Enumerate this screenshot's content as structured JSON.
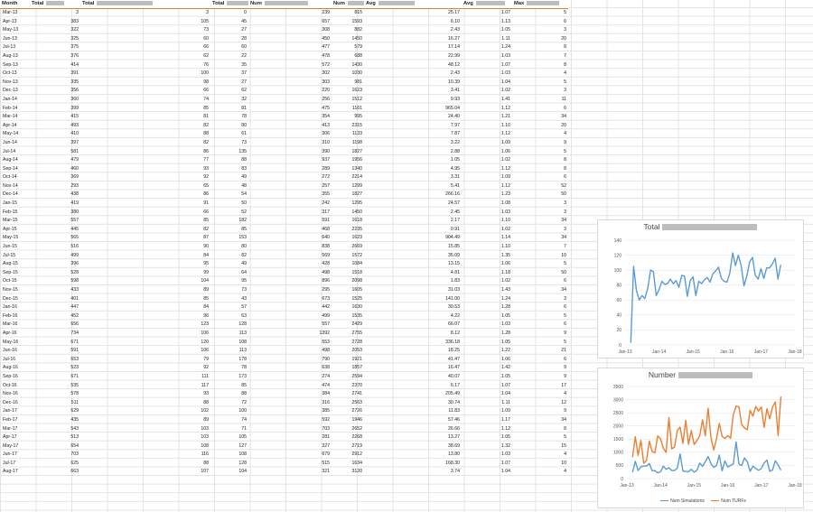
{
  "headers": [
    "Month",
    "Total",
    "Total",
    "Total",
    "Num",
    "Num",
    "Avg",
    "Avg",
    "Max"
  ],
  "rows": [
    [
      "Mar-13",
      "3",
      "3",
      "0",
      "239",
      "815",
      "25.17",
      "1.07",
      "5"
    ],
    [
      "Apr-13",
      "383",
      "105",
      "45",
      "657",
      "1593",
      "6.10",
      "1.13",
      "6"
    ],
    [
      "May-13",
      "322",
      "73",
      "27",
      "308",
      "882",
      "2.43",
      "1.05",
      "3"
    ],
    [
      "Jun-13",
      "325",
      "60",
      "28",
      "450",
      "1450",
      "16.27",
      "1.11",
      "20"
    ],
    [
      "Jul-13",
      "375",
      "66",
      "60",
      "477",
      "579",
      "17.14",
      "1.24",
      "8"
    ],
    [
      "Aug-13",
      "376",
      "62",
      "22",
      "478",
      "688",
      "22.99",
      "1.03",
      "7"
    ],
    [
      "Sep-13",
      "414",
      "76",
      "35",
      "572",
      "1430",
      "48.12",
      "1.07",
      "8"
    ],
    [
      "Oct-13",
      "391",
      "100",
      "37",
      "302",
      "1030",
      "2.43",
      "1.03",
      "4"
    ],
    [
      "Nov-13",
      "335",
      "98",
      "27",
      "303",
      "981",
      "10.39",
      "1.04",
      "5"
    ],
    [
      "Dec-13",
      "356",
      "66",
      "62",
      "220",
      "1623",
      "3.41",
      "1.02",
      "3"
    ],
    [
      "Jan-14",
      "360",
      "74",
      "32",
      "256",
      "1512",
      "9.93",
      "1.41",
      "11"
    ],
    [
      "Feb-14",
      "399",
      "85",
      "81",
      "475",
      "1161",
      "965.04",
      "1.12",
      "6"
    ],
    [
      "Mar-14",
      "415",
      "81",
      "78",
      "354",
      "995",
      "24.40",
      "1.21",
      "34"
    ],
    [
      "Apr-14",
      "493",
      "82",
      "80",
      "413",
      "2315",
      "7.97",
      "1.10",
      "20"
    ],
    [
      "May-14",
      "410",
      "88",
      "61",
      "306",
      "1133",
      "7.87",
      "1.12",
      "4"
    ],
    [
      "Jun-14",
      "397",
      "82",
      "73",
      "310",
      "1198",
      "3.22",
      "1.09",
      "9"
    ],
    [
      "Jul-14",
      "581",
      "86",
      "135",
      "390",
      "1827",
      "2.88",
      "1.06",
      "5"
    ],
    [
      "Aug-14",
      "479",
      "77",
      "88",
      "937",
      "1956",
      "1.05",
      "1.02",
      "8"
    ],
    [
      "Sep-14",
      "460",
      "93",
      "83",
      "289",
      "1340",
      "4.95",
      "1.12",
      "8"
    ],
    [
      "Oct-14",
      "369",
      "92",
      "49",
      "272",
      "2214",
      "3.31",
      "1.09",
      "6"
    ],
    [
      "Nov-14",
      "293",
      "65",
      "48",
      "257",
      "1299",
      "5.41",
      "1.12",
      "52"
    ],
    [
      "Dec-14",
      "438",
      "86",
      "54",
      "355",
      "1827",
      "266.16",
      "1.23",
      "50"
    ],
    [
      "Jan-15",
      "419",
      "91",
      "50",
      "242",
      "1295",
      "24.57",
      "1.08",
      "3"
    ],
    [
      "Feb-15",
      "380",
      "66",
      "52",
      "317",
      "1450",
      "2.45",
      "1.03",
      "3"
    ],
    [
      "Mar-15",
      "557",
      "85",
      "182",
      "591",
      "1618",
      "2.17",
      "1.10",
      "34"
    ],
    [
      "Apr-15",
      "445",
      "82",
      "85",
      "468",
      "2235",
      "0.91",
      "1.02",
      "3"
    ],
    [
      "May-15",
      "565",
      "87",
      "153",
      "640",
      "1623",
      "904.49",
      "1.14",
      "34"
    ],
    [
      "Jun-15",
      "516",
      "90",
      "80",
      "838",
      "2669",
      "15.85",
      "1.10",
      "7"
    ],
    [
      "Jul-15",
      "499",
      "84",
      "82",
      "569",
      "1572",
      "35.09",
      "1.35",
      "10"
    ],
    [
      "Aug-15",
      "396",
      "95",
      "49",
      "428",
      "1084",
      "13.15",
      "1.06",
      "5"
    ],
    [
      "Sep-15",
      "528",
      "99",
      "64",
      "498",
      "1518",
      "4.81",
      "1.18",
      "50"
    ],
    [
      "Oct-15",
      "598",
      "104",
      "95",
      "896",
      "2098",
      "1.83",
      "1.02",
      "6"
    ],
    [
      "Nov-15",
      "433",
      "89",
      "73",
      "295",
      "1605",
      "31.03",
      "1.43",
      "34"
    ],
    [
      "Dec-15",
      "401",
      "85",
      "43",
      "673",
      "1525",
      "141.00",
      "1.24",
      "3"
    ],
    [
      "Jan-16",
      "447",
      "84",
      "57",
      "442",
      "1630",
      "30.53",
      "1.28",
      "6"
    ],
    [
      "Feb-16",
      "452",
      "96",
      "63",
      "499",
      "1535",
      "4.22",
      "1.05",
      "5"
    ],
    [
      "Mar-16",
      "656",
      "123",
      "128",
      "557",
      "2429",
      "66.07",
      "1.03",
      "6"
    ],
    [
      "Apr-16",
      "734",
      "106",
      "113",
      "1392",
      "2755",
      "8.12",
      "1.28",
      "9"
    ],
    [
      "May-16",
      "671",
      "120",
      "108",
      "553",
      "2728",
      "336.18",
      "1.05",
      "5"
    ],
    [
      "Jun-16",
      "591",
      "106",
      "113",
      "498",
      "2053",
      "18.25",
      "1.22",
      "21"
    ],
    [
      "Jul-16",
      "653",
      "79",
      "178",
      "790",
      "1921",
      "41.47",
      "1.06",
      "6"
    ],
    [
      "Aug-16",
      "523",
      "92",
      "78",
      "638",
      "1857",
      "16.47",
      "1.42",
      "9"
    ],
    [
      "Sep-16",
      "671",
      "111",
      "173",
      "274",
      "2594",
      "40.07",
      "1.05",
      "9"
    ],
    [
      "Oct-16",
      "535",
      "117",
      "85",
      "474",
      "2370",
      "6.17",
      "1.07",
      "17"
    ],
    [
      "Nov-16",
      "578",
      "93",
      "88",
      "384",
      "2741",
      "205.49",
      "1.04",
      "4"
    ],
    [
      "Dec-16",
      "511",
      "88",
      "72",
      "316",
      "2563",
      "30.74",
      "1.11",
      "12"
    ],
    [
      "Jan-17",
      "629",
      "102",
      "100",
      "385",
      "2726",
      "11.83",
      "1.09",
      "9"
    ],
    [
      "Feb-17",
      "435",
      "89",
      "74",
      "592",
      "1946",
      "57.46",
      "1.17",
      "34"
    ],
    [
      "Mar-17",
      "543",
      "103",
      "71",
      "703",
      "2652",
      "26.66",
      "1.12",
      "8"
    ],
    [
      "Apr-17",
      "513",
      "103",
      "105",
      "281",
      "2268",
      "13.27",
      "1.05",
      "5"
    ],
    [
      "May-17",
      "654",
      "108",
      "127",
      "327",
      "2719",
      "38.69",
      "1.32",
      "15"
    ],
    [
      "Jun-17",
      "703",
      "116",
      "108",
      "679",
      "2912",
      "13.80",
      "1.03",
      "4"
    ],
    [
      "Jul-17",
      "625",
      "88",
      "128",
      "515",
      "1634",
      "168.30",
      "1.07",
      "10"
    ],
    [
      "Aug-17",
      "663",
      "107",
      "104",
      "321",
      "3120",
      "3.74",
      "1.04",
      "4"
    ]
  ],
  "chart_data": [
    {
      "type": "line",
      "title": "Total",
      "x_ticks": [
        "Jan-13",
        "Jan-14",
        "Jan-15",
        "Jan-16",
        "Jan-17",
        "Jan-18"
      ],
      "ylim": [
        0,
        140
      ],
      "y_ticks": [
        0,
        20,
        40,
        60,
        80,
        100,
        120,
        140
      ],
      "series": [
        {
          "values": [
            3,
            105,
            73,
            60,
            66,
            62,
            76,
            100,
            98,
            66,
            74,
            85,
            81,
            82,
            88,
            82,
            86,
            77,
            93,
            92,
            65,
            86,
            91,
            66,
            85,
            82,
            87,
            90,
            84,
            95,
            99,
            104,
            89,
            85,
            84,
            96,
            123,
            106,
            120,
            106,
            79,
            92,
            111,
            117,
            93,
            88,
            102,
            89,
            103,
            103,
            108,
            116,
            88,
            107
          ],
          "color": "#5b9bd5"
        }
      ]
    },
    {
      "type": "line",
      "title": "Number",
      "x_ticks": [
        "Jan-13",
        "Jan-14",
        "Jan-15",
        "Jan-16",
        "Jan-17",
        "Jan-18"
      ],
      "ylim": [
        0,
        3500
      ],
      "y_ticks": [
        0,
        500,
        1000,
        1500,
        2000,
        2500,
        3000,
        3500
      ],
      "series": [
        {
          "name": "Num Simulations",
          "color": "#5b9bd5",
          "values": [
            239,
            657,
            308,
            450,
            477,
            478,
            572,
            302,
            303,
            220,
            256,
            475,
            354,
            413,
            306,
            310,
            390,
            937,
            289,
            272,
            257,
            355,
            242,
            317,
            591,
            468,
            640,
            838,
            569,
            428,
            498,
            896,
            295,
            673,
            442,
            499,
            557,
            1392,
            553,
            498,
            790,
            638,
            274,
            474,
            384,
            316,
            385,
            592,
            703,
            281,
            327,
            679,
            515,
            321
          ]
        },
        {
          "name": "Num TURFs",
          "color": "#ed7d31",
          "values": [
            815,
            1593,
            882,
            1450,
            579,
            688,
            1430,
            1030,
            981,
            1623,
            1512,
            1161,
            995,
            2315,
            1133,
            1198,
            1827,
            1956,
            1340,
            2214,
            1299,
            1827,
            1295,
            1450,
            1618,
            2235,
            1623,
            2669,
            1572,
            1084,
            1518,
            2098,
            1605,
            1525,
            1630,
            1535,
            2429,
            2755,
            2728,
            2053,
            1921,
            1857,
            2594,
            2370,
            2741,
            2563,
            2726,
            1946,
            2652,
            2268,
            2719,
            2912,
            1634,
            3120
          ]
        }
      ]
    }
  ]
}
